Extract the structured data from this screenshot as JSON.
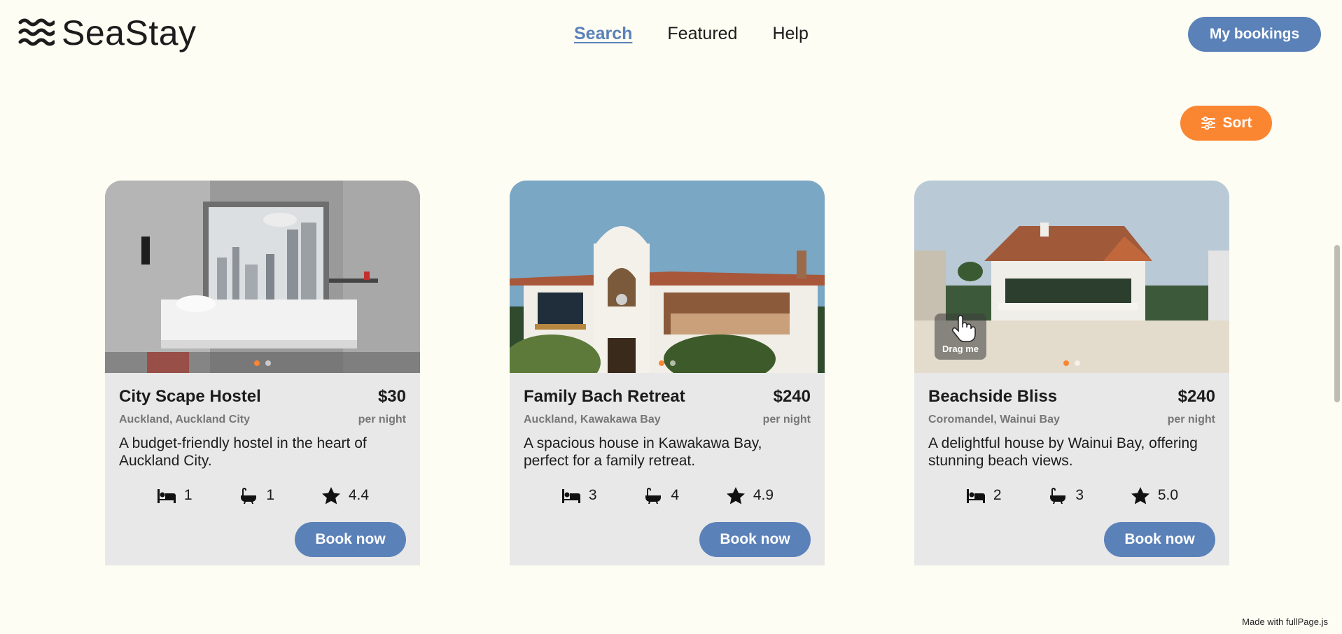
{
  "app": {
    "name": "SeaStay"
  },
  "nav": {
    "items": [
      {
        "label": "Search",
        "active": true
      },
      {
        "label": "Featured"
      },
      {
        "label": "Help"
      }
    ]
  },
  "header": {
    "my_bookings_label": "My bookings"
  },
  "toolbar": {
    "sort_label": "Sort"
  },
  "colors": {
    "primary": "#5b81b9",
    "accent": "#fb8631",
    "background": "#fdfdf3",
    "card": "#e8e8e8"
  },
  "listings": [
    {
      "title": "City Scape Hostel",
      "price": "$30",
      "per_night": "per night",
      "location": "Auckland, Auckland City",
      "description": "A budget-friendly hostel in the heart of Auckland City.",
      "beds": "1",
      "baths": "1",
      "rating": "4.4",
      "book_label": "Book now",
      "image": "hotel-room-city-view"
    },
    {
      "title": "Family Bach Retreat",
      "price": "$240",
      "per_night": "per night",
      "location": "Auckland, Kawakawa Bay",
      "description": "A spacious house in Kawakawa Bay, perfect for a family retreat.",
      "beds": "3",
      "baths": "4",
      "rating": "4.9",
      "book_label": "Book now",
      "image": "spanish-style-house"
    },
    {
      "title": "Beachside Bliss",
      "price": "$240",
      "per_night": "per night",
      "location": "Coromandel, Wainui Bay",
      "description": "A delightful house by Wainui Bay, offering stunning beach views.",
      "beds": "2",
      "baths": "3",
      "rating": "5.0",
      "book_label": "Book now",
      "image": "beach-house"
    }
  ],
  "drag_hint": "Drag me",
  "footer": {
    "note": "Made with fullPage.js"
  }
}
